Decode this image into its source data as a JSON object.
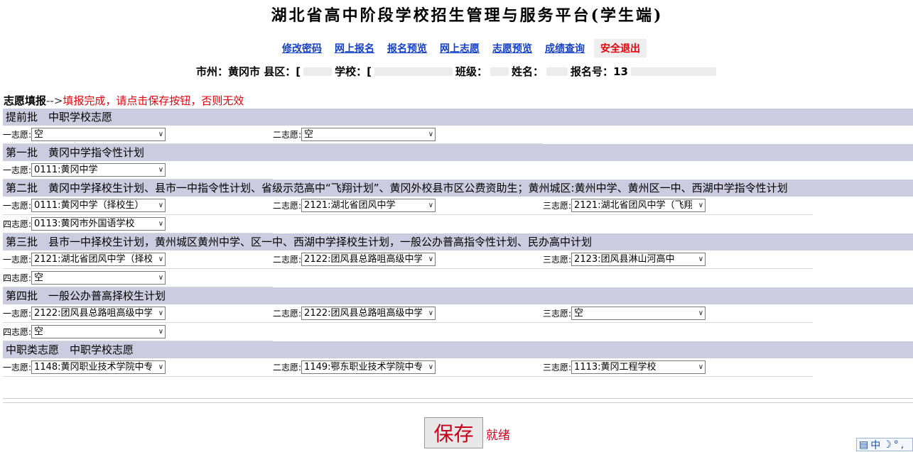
{
  "title": "湖北省高中阶段学校招生管理与服务平台(学生端)",
  "nav": [
    "修改密码",
    "网上报名",
    "报名预览",
    "网上志愿",
    "志愿预览",
    "成绩查询"
  ],
  "logout": "安全退出",
  "info": {
    "city_label": "市州：",
    "city": "黄冈市",
    "county_label": "县区：",
    "county": "[",
    "school_label": "学校：",
    "school": "[",
    "class_label": "班级：",
    "class": "",
    "name_label": "姓名：",
    "name": "",
    "regno_label": "报名号：",
    "regno": "13"
  },
  "guide": {
    "label": "志愿填报",
    "arrow": "-->",
    "warning": "填报完成，请点击保存按钮，否则无效"
  },
  "batches": [
    {
      "title": "提前批　中职学校志愿",
      "rows": [
        [
          {
            "label": "一志愿:",
            "value": "空"
          },
          {
            "label": "二志愿:",
            "value": "空"
          }
        ]
      ]
    },
    {
      "title": "第一批　黄冈中学指令性计划",
      "rows": [
        [
          {
            "label": "一志愿:",
            "value": "0111:黄冈中学"
          }
        ]
      ]
    },
    {
      "title": "第二批　黄冈中学择校生计划、县市一中指令性计划、省级示范高中“飞翔计划”、黄冈外校县市区公费资助生；黄州城区:黄州中学、黄州区一中、西湖中学指令性计划",
      "rows": [
        [
          {
            "label": "一志愿:",
            "value": "0111:黄冈中学（择校生）"
          },
          {
            "label": "二志愿:",
            "value": "2121:湖北省团风中学"
          },
          {
            "label": "三志愿:",
            "value": "2121:湖北省团风中学（飞翔"
          }
        ],
        [
          {
            "label": "四志愿:",
            "value": "0113:黄冈市外国语学校"
          }
        ]
      ]
    },
    {
      "title": "第三批　县市一中择校生计划，黄州城区黄州中学、区一中、西湖中学择校生计划，一般公办普高指令性计划、民办高中计划",
      "rows": [
        [
          {
            "label": "一志愿:",
            "value": "2121:湖北省团风中学（择校"
          },
          {
            "label": "二志愿:",
            "value": "2122:团风县总路咀高级中学"
          },
          {
            "label": "三志愿:",
            "value": "2123:团风县淋山河高中"
          }
        ],
        [
          {
            "label": "四志愿:",
            "value": "空"
          }
        ]
      ]
    },
    {
      "title": "第四批　一般公办普高择校生计划",
      "rows": [
        [
          {
            "label": "一志愿:",
            "value": "2122:团风县总路咀高级中学"
          },
          {
            "label": "二志愿:",
            "value": "2122:团风县总路咀高级中学"
          },
          {
            "label": "三志愿:",
            "value": "空"
          }
        ],
        [
          {
            "label": "四志愿:",
            "value": "空"
          }
        ]
      ]
    },
    {
      "title": "中职类志愿　中职学校志愿",
      "rows": [
        [
          {
            "label": "一志愿:",
            "value": "1148:黄冈职业技术学院中专"
          },
          {
            "label": "二志愿:",
            "value": "1149:鄂东职业技术学院中专"
          },
          {
            "label": "三志愿:",
            "value": "1113:黄冈工程学校"
          }
        ]
      ]
    }
  ],
  "save_button": "保存",
  "status": "就绪",
  "ime_text": "中",
  "colors": {
    "nav_link": "#1540c8",
    "logout": "#e8000b",
    "bar": "#cccce0",
    "warning": "#e8000b"
  }
}
